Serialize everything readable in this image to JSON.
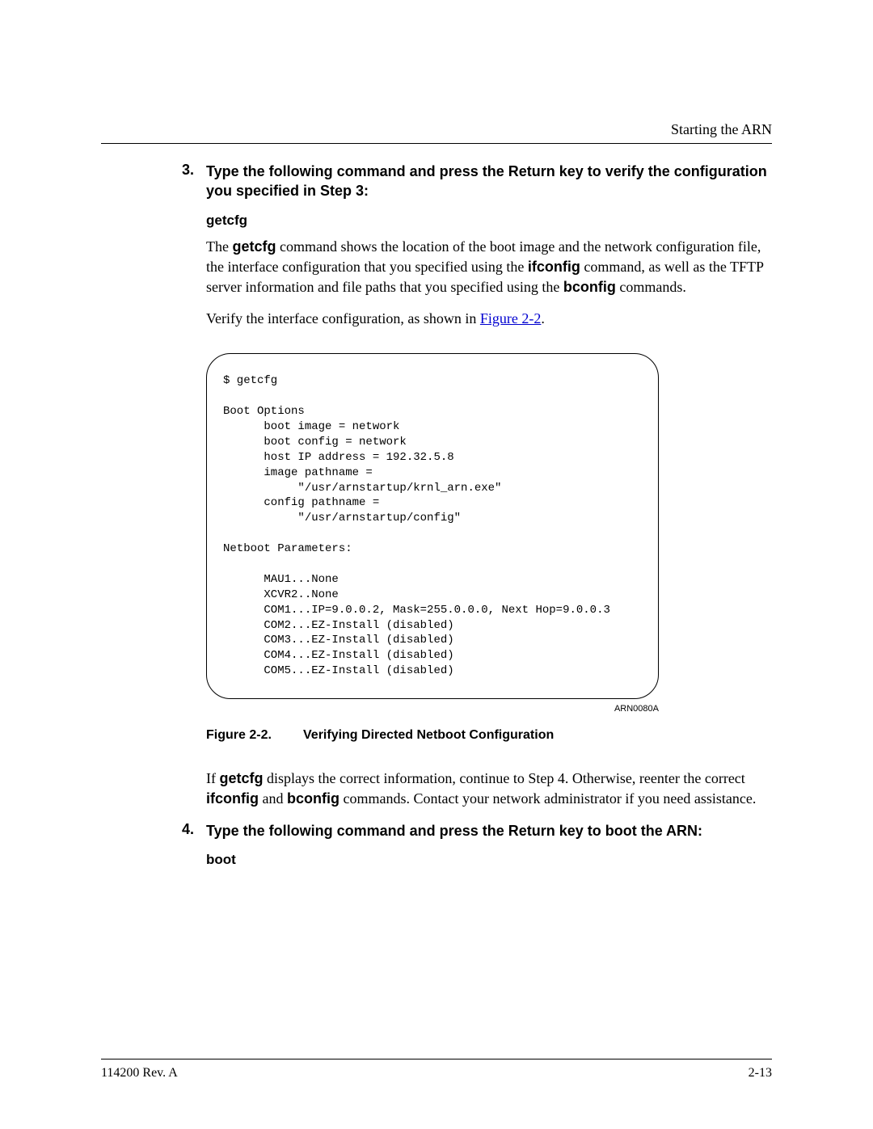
{
  "header": {
    "running_title": "Starting the ARN"
  },
  "step3": {
    "num": "3.",
    "heading": "Type the following command and press the Return key to verify the configuration you specified in Step 3:",
    "command": "getcfg",
    "para1_pre": "The ",
    "para1_b1": "getcfg",
    "para1_mid1": " command shows the location of the boot image and the network configuration file, the interface configuration that you specified using the ",
    "para1_b2": "ifconfig",
    "para1_mid2": " command, as well as the TFTP server information and file paths that you specified using the ",
    "para1_b3": "bconfig",
    "para1_tail": " commands.",
    "para2_pre": "Verify the interface configuration, as shown in ",
    "para2_link": "Figure 2-2",
    "para2_tail": "."
  },
  "figure": {
    "code": "$ getcfg\n\nBoot Options\n      boot image = network\n      boot config = network\n      host IP address = 192.32.5.8\n      image pathname =\n           \"/usr/arnstartup/krnl_arn.exe\"\n      config pathname =\n           \"/usr/arnstartup/config\"\n\nNetboot Parameters:\n\n      MAU1...None\n      XCVR2..None\n      COM1...IP=9.0.0.2, Mask=255.0.0.0, Next Hop=9.0.0.3\n      COM2...EZ-Install (disabled)\n      COM3...EZ-Install (disabled)\n      COM4...EZ-Install (disabled)\n      COM5...EZ-Install (disabled)",
    "arn_id": "ARN0080A",
    "caption_num": "Figure 2-2.",
    "caption_text": "Verifying Directed Netboot Configuration"
  },
  "after_figure": {
    "p_pre": "If ",
    "p_b1": "getcfg",
    "p_mid1": " displays the correct information, continue to Step 4. Otherwise, reenter the correct ",
    "p_b2": "ifconfig",
    "p_mid2": " and ",
    "p_b3": "bconfig",
    "p_tail": " commands. Contact your network administrator if you need assistance."
  },
  "step4": {
    "num": "4.",
    "heading": "Type the following command and press the Return key to boot the ARN:",
    "command": "boot"
  },
  "footer": {
    "left": "114200 Rev. A",
    "right": "2-13"
  }
}
